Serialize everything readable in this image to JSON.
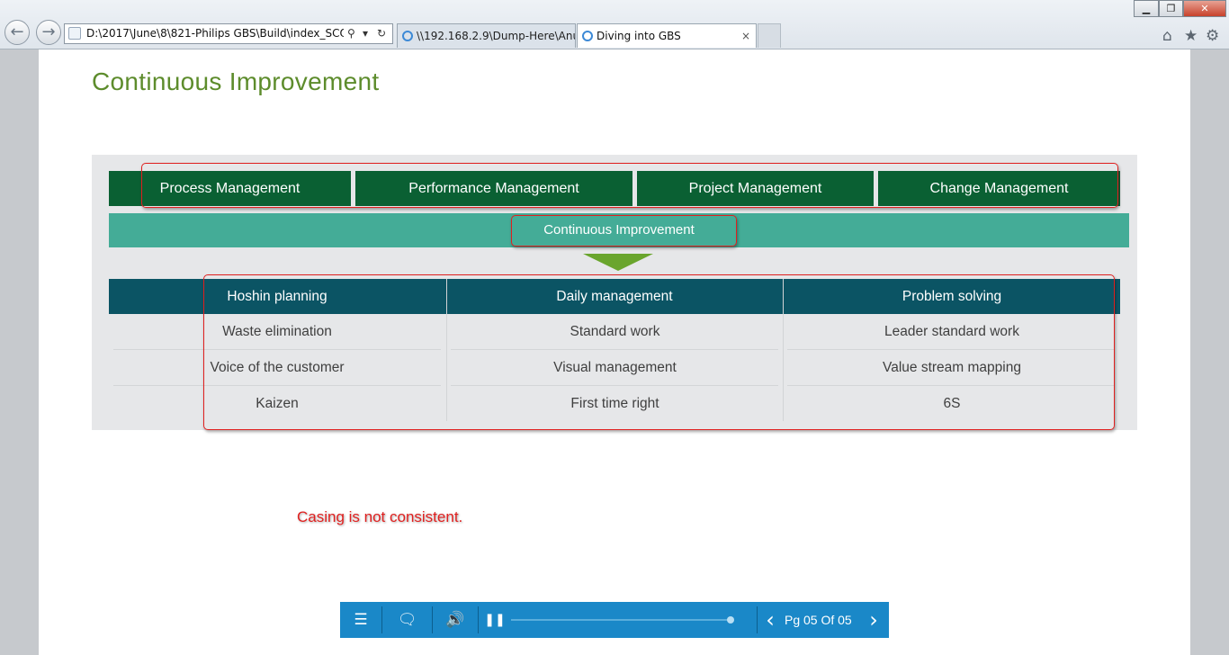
{
  "browser": {
    "back_glyph": "←",
    "forward_glyph": "→",
    "address_url": "D:\\2017\\June\\8\\821-Philips GBS\\Build\\index_SCORM.h",
    "search_glyph": "⚲",
    "dropdown_glyph": "▾",
    "refresh_glyph": "↻",
    "tabs": [
      {
        "label": "\\\\192.168.2.9\\Dump-Here\\Anu..."
      },
      {
        "label": "Diving into GBS",
        "close_glyph": "×"
      }
    ],
    "window_controls": {
      "minimize": "▁",
      "maximize": "❐",
      "close": "✕"
    },
    "toolbar_glyphs": {
      "home": "⌂",
      "favorites": "★",
      "settings": "⚙"
    }
  },
  "page": {
    "title": "Continuous Improvement",
    "management_boxes": [
      {
        "label": "Process Management"
      },
      {
        "label": "Performance Management"
      },
      {
        "label": "Project Management"
      },
      {
        "label": "Change Management"
      }
    ],
    "ci_band": "Continuous Improvement",
    "table": {
      "headers": [
        "Hoshin planning",
        "Daily management",
        "Problem solving"
      ],
      "rows": [
        [
          "Waste elimination",
          "Standard work",
          "Leader standard work"
        ],
        [
          "Voice of the customer",
          "Visual management",
          "Value stream mapping"
        ],
        [
          "Kaizen",
          "First time right",
          "6S"
        ]
      ]
    },
    "review_note": "Casing is not consistent."
  },
  "player": {
    "menu_glyph": "☰",
    "transcript_glyph": "🗨",
    "volume_glyph": "🔊",
    "pause_glyph": "❚❚",
    "prev_glyph": "‹",
    "next_glyph": "›",
    "page_label": "Pg 05 Of 05",
    "progress": 1.0
  },
  "colors": {
    "title_green": "#5d8c2c",
    "management_green": "#0a6033",
    "ci_teal": "#44ac97",
    "arrow_green": "#6aa52d",
    "table_header": "#0b5464",
    "annotation_red": "#e0201f",
    "player_blue": "#1a88c8"
  }
}
